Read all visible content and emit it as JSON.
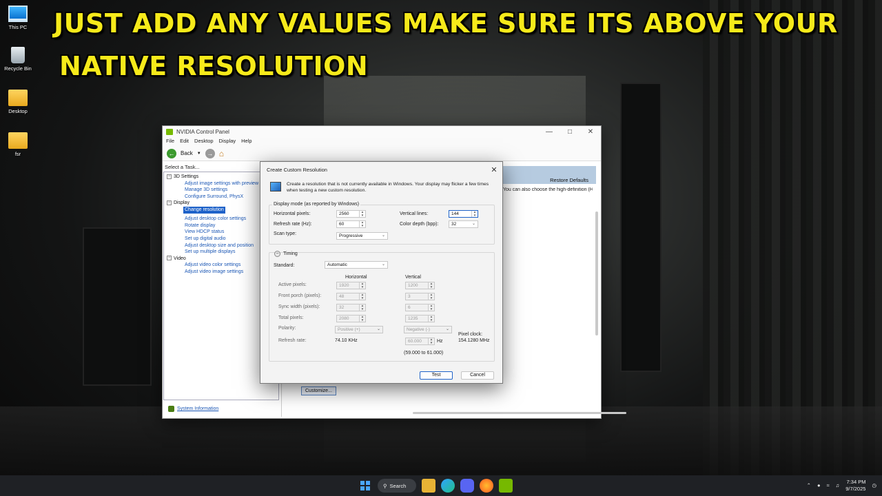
{
  "caption": {
    "line1": "Just add any values make sure its above your",
    "line2": "native resolution"
  },
  "desktop_icons": [
    {
      "label": "This PC",
      "icon": "computer-icon"
    },
    {
      "label": "Recycle Bin",
      "icon": "recycle-bin-icon"
    },
    {
      "label": "Desktop",
      "icon": "folder-icon"
    },
    {
      "label": "fsr",
      "icon": "folder-icon"
    }
  ],
  "ncp": {
    "title": "NVIDIA Control Panel",
    "menu": [
      "File",
      "Edit",
      "Desktop",
      "Display",
      "Help"
    ],
    "back_label": "Back",
    "task_label": "Select a Task...",
    "tree": {
      "settings3d": {
        "label": "3D Settings",
        "items": [
          "Adjust image settings with preview",
          "Manage 3D settings",
          "Configure Surround, PhysX"
        ]
      },
      "display": {
        "label": "Display",
        "items": [
          "Change resolution",
          "Adjust desktop color settings",
          "Rotate display",
          "View HDCP status",
          "Set up digital audio",
          "Adjust desktop size and position",
          "Set up multiple displays"
        ]
      },
      "video": {
        "label": "Video",
        "items": [
          "Adjust video color settings",
          "Adjust video image settings"
        ]
      }
    },
    "restore_defaults": "Restore Defaults",
    "right_text": "You can also choose the high-definition (H",
    "customize_label": "Customize...",
    "system_info": "System Information"
  },
  "dialog": {
    "title": "Create Custom Resolution",
    "description": "Create a resolution that is not currently available in Windows. Your display may flicker a few times when testing a new custom resolution.",
    "display_mode": {
      "legend": "Display mode (as reported by Windows)",
      "horizontal_label": "Horizontal pixels:",
      "horizontal_value": "2560",
      "vertical_label": "Vertical lines:",
      "vertical_value": "144",
      "refresh_label": "Refresh rate (Hz):",
      "refresh_value": "60",
      "color_label": "Color depth (bpp):",
      "color_value": "32",
      "scan_label": "Scan type:",
      "scan_value": "Progressive"
    },
    "timing": {
      "legend": "Timing",
      "standard_label": "Standard:",
      "standard_value": "Automatic",
      "horizontal_header": "Horizontal",
      "vertical_header": "Vertical",
      "active_label": "Active pixels:",
      "active_h": "1920",
      "active_v": "1200",
      "front_label": "Front porch (pixels):",
      "front_h": "48",
      "front_v": "3",
      "sync_label": "Sync width (pixels):",
      "sync_h": "32",
      "sync_v": "6",
      "total_label": "Total pixels:",
      "total_h": "2080",
      "total_v": "1235",
      "polarity_label": "Polarity:",
      "polarity_h": "Positive (+)",
      "polarity_v": "Negative (-)",
      "refresh_label": "Refresh rate:",
      "refresh_h": "74.10 KHz",
      "refresh_v": "60.000",
      "hz_unit": "Hz",
      "refresh_range": "(59.000 to 61.000)",
      "pixel_clock_label": "Pixel clock:",
      "pixel_clock_value": "154.1280 MHz"
    },
    "test_label": "Test",
    "cancel_label": "Cancel"
  },
  "taskbar": {
    "search_label": "Search",
    "time": "7:34 PM",
    "date": "9/7/2025"
  }
}
